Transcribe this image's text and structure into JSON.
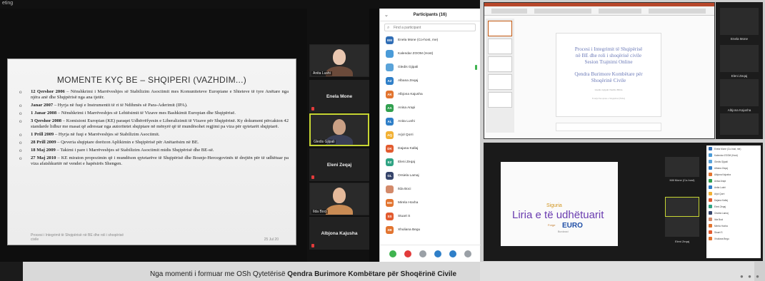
{
  "left_window": {
    "topbar_label": "eting",
    "slide": {
      "title": "MOMENTE KYÇ BE – SHQIPERI (VAZHDIM...)",
      "items": [
        {
          "bold": "12 Qershor 2006",
          "text": " – Nënshkrimi i Marrëveshjes së Stabilizim Asociimit mes Komuniteteve Europiane e Shteteve të tyre Anëtare nga njëra anë dhe Shqipërisë nga ana tjetër."
        },
        {
          "bold": "Janar 2007",
          "text": " – Hyrja në fuqi e Instrumentit të ri të Ndihmës së Para-Aderimit (IPA)."
        },
        {
          "bold": "1 Janar 2008",
          "text": " – Nënshkrimi i Marrëveshjes së Lehtësimit të Vizave mes Bashkimit Europian dhe Shqipërisë."
        },
        {
          "bold": "3 Qershor 2008",
          "text": " – Komisioni Europian (KE) paraqet Udhërrëfyesin e Liberalizimit të Vizave për Shqipërinë. Ky dokument përcakton 42 standarde lidhur me masat që adresuar nga autoritetet shqiptare në mënyrë që të mundësohet regjimi pa viza për qytetarët shqiptarë."
        },
        {
          "bold": "1 Prill 2009",
          "text": " – Hyrja në fuqi e Marrëveshjes së Stabilizim Asociimit."
        },
        {
          "bold": "28 Prill 2009",
          "text": " – Qeveria shqiptare dorëzon Aplikimin e Shqipërisë për Anëtarësim në BE."
        },
        {
          "bold": "18 Maj 2009",
          "text": " – Takimi i pare i Marrëveshjes së Stabilizim Asociimit midis Shqipërisë dhe BE-së."
        },
        {
          "bold": "27 Maj 2010",
          "text": " – KE miraton propozimin që i mundëson qytetarëve të Shqipërisë dhe Bosnje-Hercegovinës të drejtën për të udhëtuar pa viza afatshkurtër në vendet e hapësirës Shengen."
        }
      ],
      "footer": "Procesi i Integrimit të Shqipërisë në BE dhe roli i shoqërisë civile",
      "date": "25 Jul 20"
    },
    "tiles": {
      "t1_name": "Anita Lushi",
      "t2_name": "Enela Mone",
      "t3_name": "Gledis Gjipali",
      "t4_name": "Eleni Zeqaj",
      "t5_name": "Ilda Boci",
      "t6_name": "Albjona Kajusha"
    },
    "participants": {
      "title": "Participants (16)",
      "search_placeholder": "Find a participant",
      "list": [
        {
          "initials": "EM",
          "name": "Enela Mone (Co-host, me)",
          "color": "#2f6db5"
        },
        {
          "initials": "",
          "name": "Kalendar ZOOM (Host)",
          "color": "#4a9bd8"
        },
        {
          "initials": "",
          "name": "Gledis Gjipali",
          "color": "#5aa3d9"
        },
        {
          "initials": "AZ",
          "name": "Albana Zeqaj",
          "color": "#2f7fc8"
        },
        {
          "initials": "AK",
          "name": "Albjona Kajusha",
          "color": "#e2742f"
        },
        {
          "initials": "AA",
          "name": "Anisa Arapi",
          "color": "#31a04f"
        },
        {
          "initials": "AL",
          "name": "Anita Lushi",
          "color": "#2f7fc8"
        },
        {
          "initials": "AQ",
          "name": "Arjol Qorri",
          "color": "#f2b134"
        },
        {
          "initials": "DK",
          "name": "Dajana Kallaj",
          "color": "#e25b2f"
        },
        {
          "initials": "EZ",
          "name": "Eleni Zeqaj",
          "color": "#2fa383"
        },
        {
          "initials": "GL",
          "name": "Orsiela Lamaj",
          "color": "#36456b"
        },
        {
          "initials": "",
          "name": "Ilda Boci",
          "color": "#d38a6a"
        },
        {
          "initials": "MH",
          "name": "Mirela Hoxha",
          "color": "#e2742f"
        },
        {
          "initials": "SS",
          "name": "Stuart S",
          "color": "#e25b2f"
        },
        {
          "initials": "XB",
          "name": "Xhuliana Begu",
          "color": "#e2742f"
        }
      ]
    }
  },
  "right_top": {
    "slide_line1": "Procesi i Integrimit të Shqipërisë",
    "slide_line2": "në BE dhe roli i shoqërisë civile",
    "slide_line3": "Sesion Trajnimi Online",
    "slide_line4": "Qendra Burimore Kombëtare për",
    "slide_line5": "Shoqërinë Civile",
    "slide_small": "Gledis Gjipali\nNertila Bibla",
    "slide_small2": "Fondja Europiane e Shqipërisë (EMA)",
    "side_labels": [
      "Enela Mone",
      "Eleni Zeqaj",
      "Albjona Kajusha"
    ]
  },
  "right_bottom": {
    "w1": "Siguria",
    "w2": "Liria e të udhëtuarit",
    "w3": "EURO",
    "w4": "Forge",
    "w5": "Burokraci",
    "vid_labels": [
      "Mili Mone (Co-host)",
      "Eleni Zeqaj"
    ]
  },
  "caption": {
    "prefix": "Nga momenti i formuar me OSh Qytetërisë ",
    "bold": "Qendra Burimore Kombëtare për Shoqërinë Civile"
  }
}
